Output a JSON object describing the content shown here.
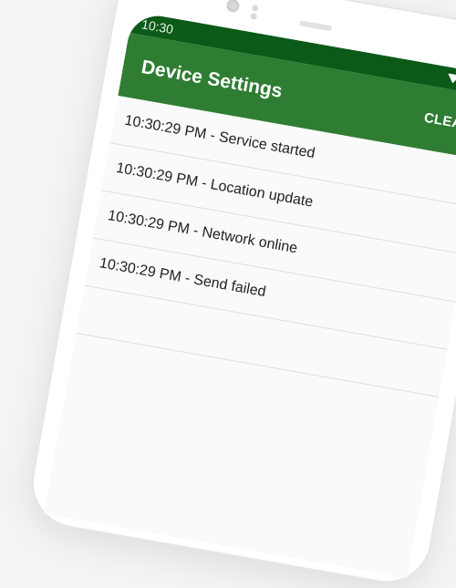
{
  "status_bar": {
    "time": "10:30"
  },
  "app_bar": {
    "title": "Device Settings",
    "clear_label": "CLEAR"
  },
  "log": {
    "entries": [
      "10:30:29 PM - Service started",
      "10:30:29 PM - Location update",
      "10:30:29 PM - Network online",
      "10:30:29 PM - Send failed"
    ]
  },
  "colors": {
    "status_bar_bg": "#0b5a17",
    "app_bar_bg": "#2e7d32"
  },
  "icons": [
    "wifi-icon",
    "signal-icon",
    "battery-icon"
  ]
}
